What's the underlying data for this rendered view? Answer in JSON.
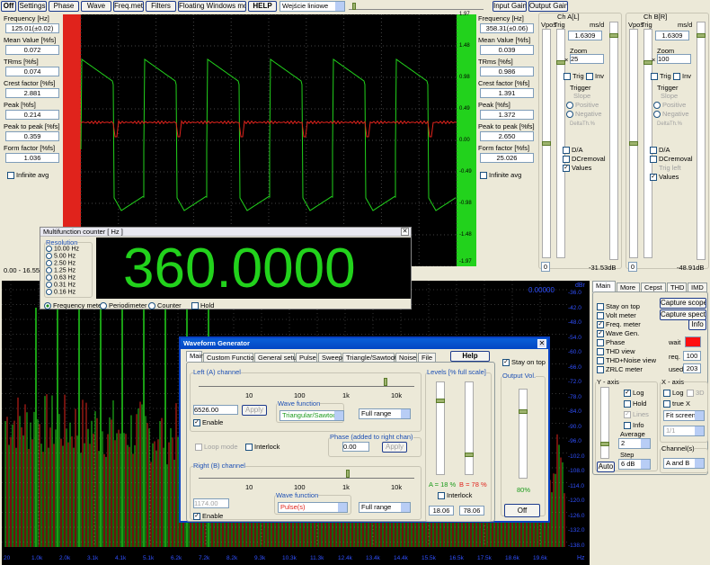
{
  "toolbar": {
    "off": "Off",
    "settings": "Settings",
    "phase": "Phase",
    "wave": "Wave",
    "freq_meter": "Freq.meter",
    "filters": "Filters",
    "floating": "Floating Windows mode",
    "help": "HELP",
    "input_select": "Wejście liniowe",
    "input_gain": "Input Gain",
    "output_gain": "Output Gain"
  },
  "left_stats": [
    {
      "label": "Frequency [Hz]",
      "value": "125.01(±0.02)"
    },
    {
      "label": "Mean Value [%fs]",
      "value": "0.072"
    },
    {
      "label": "TRms [%fs]",
      "value": "0.074"
    },
    {
      "label": "Crest factor [%fs]",
      "value": "2.881"
    },
    {
      "label": "Peak [%fs]",
      "value": "0.214"
    },
    {
      "label": "Peak to peak [%fs]",
      "value": "0.359"
    },
    {
      "label": "Form factor [%fs]",
      "value": "1.036"
    }
  ],
  "right_stats": [
    {
      "label": "Frequency [Hz]",
      "value": "358.31(±0.06)"
    },
    {
      "label": "Mean Value [%fs]",
      "value": "0.039"
    },
    {
      "label": "TRms [%fs]",
      "value": "0.986"
    },
    {
      "label": "Crest factor [%fs]",
      "value": "1.391"
    },
    {
      "label": "Peak [%fs]",
      "value": "1.372"
    },
    {
      "label": "Peak to peak [%fs]",
      "value": "2.650"
    },
    {
      "label": "Form factor [%fs]",
      "value": "25.026"
    }
  ],
  "infinite_avg": "Infinite avg",
  "scope_scale": [
    "1.97",
    "1.48",
    "0.98",
    "0.49",
    "0.00",
    "-0.49",
    "-0.98",
    "-1.48",
    "-1.97"
  ],
  "time_range": "0.00 - 16.55m",
  "ch_a": {
    "title": "Ch A[L]",
    "vpos": "Vpos",
    "trig": "Trig",
    "ms_div": "ms/d",
    "trig_val": "1.6309",
    "zoom_label": "Zoom",
    "zoom": "25",
    "trig_chk": "Trig",
    "inv": "Inv",
    "trigger": "Trigger",
    "slope": "Slope",
    "positive": "Positive",
    "negative": "Negative",
    "delta": "DeltaTh.%",
    "da": "D/A",
    "dc": "DCremoval",
    "values": "Values",
    "vpos_val": "0",
    "db": "-31.53dB"
  },
  "ch_b": {
    "title": "Ch B[R]",
    "vpos": "Vpos",
    "trig": "Trig",
    "ms_div": "ms/d",
    "trig_val": "1.6309",
    "zoom_label": "Zoom",
    "zoom": "100",
    "trig_chk": "Trig",
    "inv": "Inv",
    "trigger": "Trigger",
    "slope": "Slope",
    "positive": "Positive",
    "negative": "Negative",
    "delta": "DeltaTh.%",
    "da": "D/A",
    "dc": "DCremoval",
    "trig_left": "Trig left",
    "values": "Values",
    "vpos_val": "0",
    "db": "-48.91dB"
  },
  "counter": {
    "title": "Multifunction counter [ Hz ]",
    "resolution": "Resolution",
    "resolutions": [
      "10.00 Hz",
      "5.00 Hz",
      "2.50 Hz",
      "1.25 Hz",
      "0.63 Hz",
      "0.31 Hz",
      "0.16 Hz"
    ],
    "reading": "360.0000",
    "modes": [
      "Frequency meter",
      "Periodimeter",
      "Counter"
    ],
    "hold": "Hold"
  },
  "spectrum": {
    "peak": "0.00000",
    "db_unit": "dBr",
    "db_scale": [
      "-36.0",
      "-42.0",
      "-48.0",
      "-54.0",
      "-60.0",
      "-66.0",
      "-72.0",
      "-78.0",
      "-84.0",
      "-90.0",
      "-96.0",
      "-102.0",
      "-108.0",
      "-114.0",
      "-120.0",
      "-126.0",
      "-132.0",
      "-138.0"
    ],
    "freq_scale": [
      "20",
      "1.0k",
      "2.0k",
      "3.1k",
      "4.1k",
      "5.1k",
      "6.2k",
      "7.2k",
      "8.2k",
      "9.3k",
      "10.3k",
      "11.3k",
      "12.4k",
      "13.4k",
      "14.4k",
      "15.5k",
      "16.5k",
      "17.5k",
      "18.6k",
      "19.6k"
    ],
    "hz": "Hz"
  },
  "right_panel": {
    "tabs": [
      "Main",
      "More",
      "Cepst",
      "THD",
      "IMD"
    ],
    "checks": [
      {
        "label": "Stay on top",
        "checked": false
      },
      {
        "label": "Volt meter",
        "checked": false
      },
      {
        "label": "Freq. meter",
        "checked": true
      },
      {
        "label": "Wave Gen.",
        "checked": true
      },
      {
        "label": "Phase",
        "checked": false
      },
      {
        "label": "THD view",
        "checked": false
      },
      {
        "label": "THD+Noise view",
        "checked": false
      },
      {
        "label": "ZRLC meter",
        "checked": false
      }
    ],
    "capture_scope": "Capture scope",
    "capture_spectrum": "Capture spectrum",
    "info": "Info",
    "wait": "wait",
    "req": "req.",
    "req_val": "100",
    "used": "used",
    "used_val": "203",
    "y_axis": "Y - axis",
    "x_axis": "X - axis",
    "log": "Log",
    "hold": "Hold",
    "lines": "Lines",
    "info_chk": "Info",
    "log_x": "Log",
    "three_d": "3D",
    "true_x": "true X",
    "fit_screen": "Fit screen",
    "ratio": "1/1",
    "average": "Average",
    "avg_val": "2",
    "step": "Step",
    "step_val": "6 dB",
    "auto": "Auto",
    "channels": "Channel(s)",
    "channels_val": "A and B"
  },
  "wavegen": {
    "title": "Waveform Generator",
    "tabs": [
      "Main",
      "Custom Function",
      "General setup",
      "Pulse",
      "Sweep",
      "Triangle/Sawtooth",
      "Noise",
      "File"
    ],
    "help": "Help",
    "left_channel": "Left (A) channel",
    "scale": [
      "10",
      "100",
      "1k",
      "10k"
    ],
    "left_freq": "6526.00",
    "apply": "Apply",
    "wave_function": "Wave function",
    "left_wave": "Triangular/Sawtooth",
    "full_range": "Full range",
    "enable": "Enable",
    "loop_mode": "Loop mode",
    "interlock": "Interlock",
    "phase_label": "Phase (added to right chan)",
    "phase_val": "0.00",
    "right_channel": "Right (B) channel",
    "right_freq": "1174.00",
    "right_wave": "Pulse(s)",
    "levels": "Levels [% full scale]",
    "a_pct": "A = 18 %",
    "b_pct": "B = 78 %",
    "interlock2": "Interlock",
    "level_a": "18.06",
    "level_b": "78.06",
    "stay_on_top": "Stay on top",
    "output_vol": "Output Vol.",
    "output_pct": "80%",
    "off": "Off"
  },
  "colors": {
    "green": "#22d21c",
    "red": "#e0231c",
    "scope_bg": "#000000"
  }
}
